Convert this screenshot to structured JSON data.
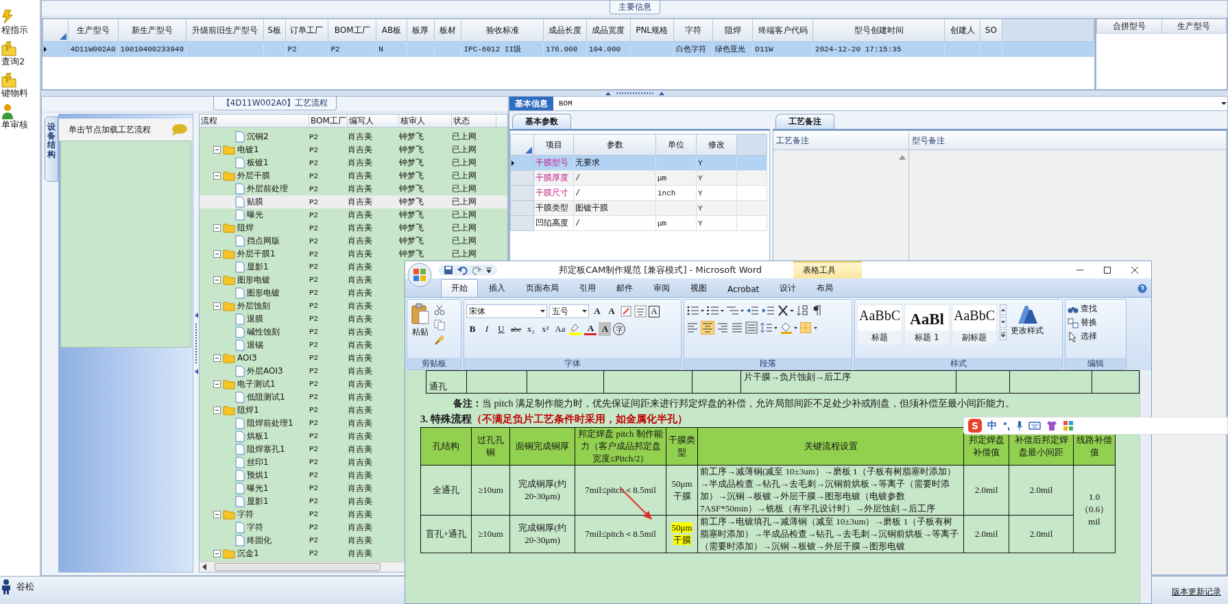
{
  "nav": {
    "items": [
      {
        "label": "程指示"
      },
      {
        "label": "查询2"
      },
      {
        "label": "键物料"
      },
      {
        "label": "单审核"
      }
    ]
  },
  "main_info": {
    "title": "主要信息",
    "columns": [
      "生产型号",
      "新生产型号",
      "升级前旧生产型号",
      "S板",
      "订单工厂",
      "BOM工厂",
      "AB板",
      "板厚",
      "板材",
      "验收标准",
      "成品长度",
      "成品宽度",
      "PNL规格",
      "字符",
      "阻焊",
      "终端客户代码",
      "型号创建时间",
      "创建人",
      "SO"
    ],
    "rows": [
      {
        "selected": true,
        "cells": [
          "4D11W002A0",
          "10010400233949",
          null,
          null,
          "P2",
          "P2",
          "N",
          null,
          null,
          "IPC-6012 II级",
          "176.000",
          "104.000",
          null,
          "白色字符",
          "绿色亚光",
          "D11W",
          "2024-12-20 17:15:35",
          null,
          null
        ]
      }
    ],
    "side_columns": [
      "合拼型号",
      "生产型号"
    ]
  },
  "process": {
    "title": "【4D11W002A0】工艺流程",
    "side_tab": "设备结构",
    "hint": "单击节点加载工艺流程",
    "columns": [
      "流程",
      "BOM工厂",
      "编写人",
      "核审人",
      "状态"
    ],
    "nodes": [
      {
        "label": "沉铜2",
        "kind": "file",
        "bom": "P2",
        "writer": "肖吉美",
        "reviewer": "钟梦飞",
        "status": "已上网",
        "selected": false
      },
      {
        "label": "电镀1",
        "kind": "folder",
        "expanded": true,
        "bom": "P2",
        "writer": "肖吉美",
        "reviewer": "钟梦飞",
        "status": "已上网",
        "selected": false,
        "children": [
          {
            "label": "板镀1",
            "kind": "file",
            "bom": "P2",
            "writer": "肖吉美",
            "reviewer": "钟梦飞",
            "status": "已上网",
            "selected": false
          }
        ]
      },
      {
        "label": "外层干膜",
        "kind": "folder",
        "expanded": true,
        "bom": "P2",
        "writer": "肖吉美",
        "reviewer": "钟梦飞",
        "status": "已上网",
        "selected": false,
        "children": [
          {
            "label": "外层前处理",
            "kind": "file",
            "bom": "P2",
            "writer": "肖吉美",
            "reviewer": "钟梦飞",
            "status": "已上网",
            "selected": false
          },
          {
            "label": "贴膜",
            "kind": "file",
            "bom": "P2",
            "writer": "肖吉美",
            "reviewer": "钟梦飞",
            "status": "已上网",
            "selected": true
          },
          {
            "label": "曝光",
            "kind": "file",
            "bom": "P2",
            "writer": "肖吉美",
            "reviewer": "钟梦飞",
            "status": "已上网",
            "selected": false
          }
        ]
      },
      {
        "label": "阻焊",
        "kind": "folder",
        "expanded": true,
        "bom": "P2",
        "writer": "肖吉美",
        "reviewer": "钟梦飞",
        "status": "已上网",
        "selected": false,
        "children": [
          {
            "label": "挡点网版",
            "kind": "file",
            "bom": "P2",
            "writer": "肖吉美",
            "reviewer": "钟梦飞",
            "status": "已上网",
            "selected": false
          }
        ]
      },
      {
        "label": "外层干膜1",
        "kind": "folder",
        "expanded": true,
        "bom": "P2",
        "writer": "肖吉美",
        "reviewer": "钟梦飞",
        "status": "已上网",
        "selected": false,
        "children": [
          {
            "label": "显影1",
            "kind": "file",
            "bom": "P2",
            "writer": "肖吉美",
            "selected": false
          }
        ]
      },
      {
        "label": "图形电镀",
        "kind": "folder",
        "expanded": true,
        "bom": "P2",
        "writer": "肖吉美",
        "selected": false,
        "children": [
          {
            "label": "图形电镀",
            "kind": "file",
            "bom": "P2",
            "writer": "肖吉美",
            "selected": false
          }
        ]
      },
      {
        "label": "外层蚀刻",
        "kind": "folder",
        "expanded": true,
        "bom": "P2",
        "writer": "肖吉美",
        "selected": false,
        "children": [
          {
            "label": "退膜",
            "kind": "file",
            "bom": "P2",
            "writer": "肖吉美",
            "selected": false
          },
          {
            "label": "碱性蚀刻",
            "kind": "file",
            "bom": "P2",
            "writer": "肖吉美",
            "selected": false
          },
          {
            "label": "退锡",
            "kind": "file",
            "bom": "P2",
            "writer": "肖吉美",
            "selected": false
          }
        ]
      },
      {
        "label": "AOI3",
        "kind": "folder",
        "expanded": true,
        "bom": "P2",
        "writer": "肖吉美",
        "selected": false,
        "children": [
          {
            "label": "外层AOI3",
            "kind": "file",
            "bom": "P2",
            "writer": "肖吉美",
            "selected": false
          }
        ]
      },
      {
        "label": "电子测试1",
        "kind": "folder",
        "expanded": true,
        "bom": "P2",
        "writer": "肖吉美",
        "selected": false,
        "children": [
          {
            "label": "低阻测试1",
            "kind": "file",
            "bom": "P2",
            "writer": "肖吉美",
            "selected": false
          }
        ]
      },
      {
        "label": "阻焊1",
        "kind": "folder",
        "expanded": true,
        "bom": "P2",
        "writer": "肖吉美",
        "selected": false,
        "children": [
          {
            "label": "阻焊前处理1",
            "kind": "file",
            "bom": "P2",
            "writer": "肖吉美",
            "selected": false
          },
          {
            "label": "烘板1",
            "kind": "file",
            "bom": "P2",
            "writer": "肖吉美",
            "selected": false
          },
          {
            "label": "阻焊塞孔1",
            "kind": "file",
            "bom": "P2",
            "writer": "肖吉美",
            "selected": false
          },
          {
            "label": "丝印1",
            "kind": "file",
            "bom": "P2",
            "writer": "肖吉美",
            "selected": false
          },
          {
            "label": "预烘1",
            "kind": "file",
            "bom": "P2",
            "writer": "肖吉美",
            "selected": false
          },
          {
            "label": "曝光1",
            "kind": "file",
            "bom": "P2",
            "writer": "肖吉美",
            "selected": false
          },
          {
            "label": "显影1",
            "kind": "file",
            "bom": "P2",
            "writer": "肖吉美",
            "selected": false
          }
        ]
      },
      {
        "label": "字符",
        "kind": "folder",
        "expanded": true,
        "bom": "P2",
        "writer": "肖吉美",
        "selected": false,
        "children": [
          {
            "label": "字符",
            "kind": "file",
            "bom": "P2",
            "writer": "肖吉美",
            "selected": false
          },
          {
            "label": "终固化",
            "kind": "file",
            "bom": "P2",
            "writer": "肖吉美",
            "selected": false
          }
        ]
      },
      {
        "label": "沉金1",
        "kind": "folder",
        "expanded": true,
        "bom": "P2",
        "writer": "肖吉美",
        "selected": false
      }
    ]
  },
  "detail": {
    "tabs": [
      {
        "label": "基本信息",
        "selected": true
      },
      {
        "label": "BOM",
        "selected": false
      }
    ],
    "params": {
      "tab": "基本参数",
      "columns": [
        "项目",
        "参数",
        "单位",
        "修改"
      ],
      "rows": [
        {
          "item": "干膜型号",
          "value": "无要求",
          "modified": "Y",
          "emphasized": true,
          "selected": true
        },
        {
          "item": "干膜厚度",
          "value": "/",
          "unit": "μm",
          "modified": "Y",
          "emphasized": true,
          "selected": false
        },
        {
          "item": "干膜尺寸",
          "value": "/",
          "unit": "inch",
          "modified": "Y",
          "emphasized": true,
          "selected": false
        },
        {
          "item": "干膜类型",
          "value": "图镀干膜",
          "modified": "Y",
          "emphasized": false,
          "selected": false
        },
        {
          "item": "凹陷高度",
          "value": "/",
          "unit": "μm",
          "modified": "Y",
          "emphasized": false,
          "selected": false
        }
      ]
    },
    "notes": {
      "tab": "工艺备注",
      "columns": [
        "工艺备注",
        "型号备注"
      ]
    }
  },
  "word": {
    "title": "邦定板CAM制作规范 [兼容模式] - Microsoft Word",
    "context_tab": "表格工具",
    "tabs": [
      {
        "label": "开始",
        "selected": true
      },
      {
        "label": "插入",
        "selected": false
      },
      {
        "label": "页面布局",
        "selected": false
      },
      {
        "label": "引用",
        "selected": false
      },
      {
        "label": "邮件",
        "selected": false
      },
      {
        "label": "审阅",
        "selected": false
      },
      {
        "label": "视图",
        "selected": false
      },
      {
        "label": "Acrobat",
        "selected": false
      },
      {
        "label": "设计",
        "selected": false
      },
      {
        "label": "布局",
        "selected": false
      }
    ],
    "clipboard": {
      "label": "剪贴板",
      "paste": "粘贴"
    },
    "font": {
      "label": "字体",
      "name": "宋体",
      "size": "五号",
      "row1_buttons": [
        {
          "text": "A",
          "kind": "grow"
        },
        {
          "text": "A",
          "kind": "shrink"
        },
        {
          "text": "A",
          "kind": "border"
        }
      ],
      "format_buttons": [
        {
          "text": "B",
          "kind": "bold"
        },
        {
          "text": "I",
          "kind": "italic"
        },
        {
          "text": "U",
          "kind": "underline"
        },
        {
          "text": "abc",
          "kind": "strike"
        },
        {
          "text": "x₂",
          "kind": "sub"
        },
        {
          "text": "x²",
          "kind": "sup"
        },
        {
          "text": "Aa",
          "kind": "case"
        }
      ],
      "row2_buttons": [
        {
          "text": "A",
          "kind": "color"
        },
        {
          "text": "A",
          "kind": "shade"
        },
        {
          "text": "字",
          "kind": "enclose"
        }
      ]
    },
    "paragraph": {
      "label": "段落",
      "alignments": [
        {
          "kind": "left",
          "selected": false
        },
        {
          "kind": "center",
          "selected": true
        },
        {
          "kind": "right",
          "selected": false
        },
        {
          "kind": "justify",
          "selected": false
        },
        {
          "kind": "distributed",
          "selected": false
        }
      ]
    },
    "styles": {
      "label": "样式",
      "items": [
        {
          "sample": "AaBbC",
          "name": "标题",
          "kind": "plain"
        },
        {
          "sample": "AaBl",
          "name": "标题 1",
          "kind": "heading"
        },
        {
          "sample": "AaBbC",
          "name": "副标题",
          "kind": "plain"
        }
      ],
      "change": "更改样式"
    },
    "editing": {
      "label": "编辑",
      "items": [
        {
          "label": "查找",
          "kind": "find"
        },
        {
          "label": "替换",
          "kind": "replace"
        },
        {
          "label": "选择",
          "kind": "select"
        }
      ]
    },
    "doc": {
      "prev_row": [
        "通孔",
        "片干膜→负片蚀刻→后工序"
      ],
      "note": "**备注：**当 pitch 满足制作能力时，优先保证间距来进行邦定焊盘的补偿，允许局部间距不足处少补或削盘，但须补偿至最小间距能力。",
      "heading": "3.  特殊流程",
      "heading_note": "（不满足负片工艺条件时采用，如金属化半孔）",
      "columns": [
        "孔结构",
        "过孔孔铜",
        "面铜完成铜厚",
        "邦定焊盘 pitch 制作能力（客户成品邦定盘宽度≤Pitch/2）",
        "干膜类型",
        "关键流程设置",
        "邦定焊盘补偿值",
        "补偿后邦定焊盘最小间距",
        "线路补偿值"
      ],
      "rows": [
        {
          "cells": [
            "全通孔",
            "≥10um",
            "完成铜厚(约 20-30μm)",
            "7mil≤pitch＜8.5mil",
            "50μm干膜",
            "前工序→减薄铜(减至 10±3um）→磨板 1（子板有树脂塞时添加）→半成品检查→钻孔→去毛刺→沉铜前烘板→等离子（需要时添加）→沉铜→板镀→外层干膜→图形电镀（电镀参数 7ASF*50min）→铣板（有半孔设计时）→外层蚀刻→后工序",
            "2.0mil",
            "2.0mil"
          ],
          "film_highlight": false
        },
        {
          "cells": [
            "盲孔+通孔",
            "≥10um",
            "完成铜厚(约 20-30μm)",
            "7mil≤pitch＜8.5mil",
            "50μm干膜",
            "前工序→电镀填孔→减薄铜（减至 10±3um）→磨板 1（子板有树脂塞时添加）→半成品检查→钻孔→去毛刺→沉铜前烘板→等离子（需要时添加）→沉铜→板镀→外层干膜→图形电镀",
            "2.0mil",
            "2.0mil"
          ],
          "film_highlight": true
        }
      ],
      "merged_value": "1.0（0.6）mil"
    }
  },
  "ime_toolbar": {
    "logo": "S",
    "mode": "中"
  },
  "status_bar": {
    "user": "谷松",
    "link": "版本更新记录"
  }
}
